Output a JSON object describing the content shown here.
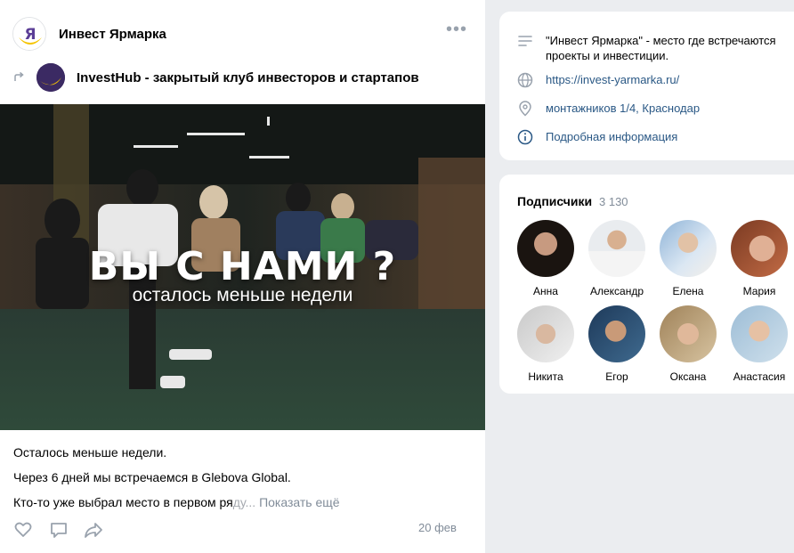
{
  "post": {
    "author": "Инвест Ярмарка",
    "repost_source": "InvestHub - закрытый клуб инвесторов и стартапов",
    "image": {
      "headline": "ВЫ С НАМИ ?",
      "subheadline": "осталось меньше недели"
    },
    "text_lines": [
      "Осталось меньше недели.",
      "Через 6 дней мы встречаемся в Glebova Global.",
      "Кто-то уже выбрал место в первом ря",
      "ду..."
    ],
    "show_more_label": "Показать ещё",
    "date": "20 фев",
    "icons": [
      "more-icon",
      "repost-arrow-icon",
      "like-icon",
      "comment-icon",
      "share-icon"
    ]
  },
  "info": {
    "description": "\"Инвест Ярмарка\" - место где встречаются проекты и инвестиции.",
    "website": "https://invest-yarmarka.ru/",
    "address": "монтажников 1/4, Краснодар",
    "details_label": "Подробная информация",
    "icons": [
      "description-icon",
      "globe-icon",
      "location-icon",
      "info-icon"
    ]
  },
  "subscribers": {
    "title": "Подписчики",
    "count": "3 130",
    "people": [
      {
        "name": "Анна"
      },
      {
        "name": "Александр"
      },
      {
        "name": "Елена"
      },
      {
        "name": "Мария"
      },
      {
        "name": "Никита"
      },
      {
        "name": "Егор"
      },
      {
        "name": "Оксана"
      },
      {
        "name": "Анастасия"
      }
    ]
  },
  "colors": {
    "link": "#2a5885",
    "muted": "#818c99",
    "background": "#ebedf0",
    "logo_yellow": "#f5c400",
    "logo_purple": "#5b3e96"
  }
}
